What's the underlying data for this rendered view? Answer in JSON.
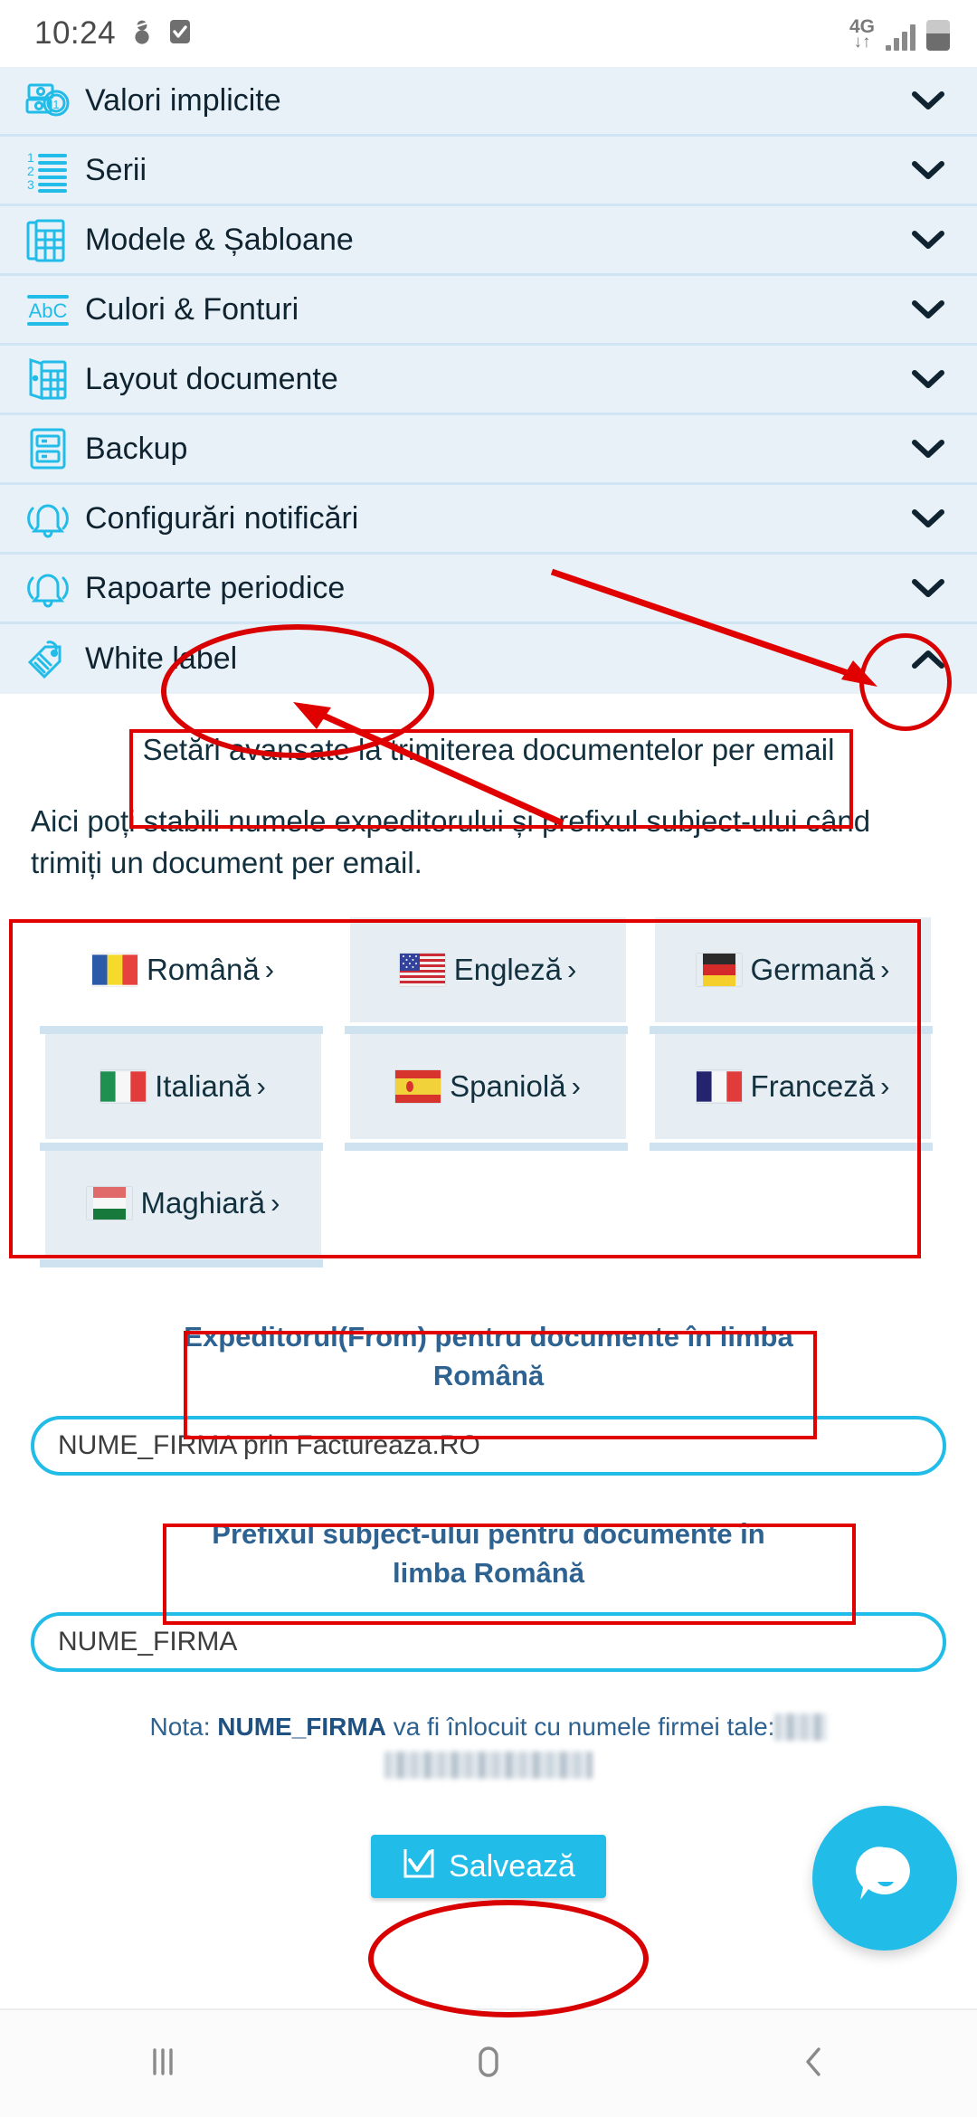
{
  "status_bar": {
    "clock": "10:24",
    "network_type": "4G",
    "icons": [
      "snowman-icon",
      "checkbox-icon",
      "data-transfer-icon",
      "signal-icon",
      "battery-icon"
    ]
  },
  "accordion": {
    "items": [
      {
        "label": "Valori implicite",
        "icon": "money-icon",
        "chevron": "chevron-down",
        "expanded": false
      },
      {
        "label": "Serii",
        "icon": "numbered-list-icon",
        "chevron": "chevron-down",
        "expanded": false
      },
      {
        "label": "Modele & Șabloane",
        "icon": "templates-icon",
        "chevron": "chevron-down",
        "expanded": false
      },
      {
        "label": "Culori & Fonturi",
        "icon": "abc-icon",
        "chevron": "chevron-down",
        "expanded": false
      },
      {
        "label": "Layout documente",
        "icon": "layout-icon",
        "chevron": "chevron-down",
        "expanded": false
      },
      {
        "label": "Backup",
        "icon": "server-icon",
        "chevron": "chevron-down",
        "expanded": false
      },
      {
        "label": "Configurări notificări",
        "icon": "bell-icon",
        "chevron": "chevron-down",
        "expanded": false
      },
      {
        "label": "Rapoarte periodice",
        "icon": "bell-icon",
        "chevron": "chevron-down",
        "expanded": false
      },
      {
        "label": "White label",
        "icon": "tag-icon",
        "chevron": "chevron-up",
        "expanded": true
      }
    ]
  },
  "panel": {
    "title": "Setări avansate la trimiterea documentelor per email",
    "description": "Aici poți stabili numele expeditorului și prefixul subject-ului când trimiți un document per email.",
    "languages": [
      {
        "name": "Română",
        "flag": "ro",
        "selected": true,
        "arrow": "›"
      },
      {
        "name": "Engleză",
        "flag": "us",
        "selected": false,
        "arrow": "›"
      },
      {
        "name": "Germană",
        "flag": "de",
        "selected": false,
        "arrow": "›"
      },
      {
        "name": "Italiană",
        "flag": "it",
        "selected": false,
        "arrow": "›"
      },
      {
        "name": "Spaniolă",
        "flag": "es",
        "selected": false,
        "arrow": "›"
      },
      {
        "name": "Franceză",
        "flag": "fr",
        "selected": false,
        "arrow": "›"
      },
      {
        "name": "Maghiară",
        "flag": "hu",
        "selected": false,
        "arrow": "›"
      }
    ],
    "from_label": "Expeditorul(From) pentru documente în limba Română",
    "from_value": "NUME_FIRMA prin Factureaza.RO",
    "subject_label": "Prefixul subject-ului pentru documente în limba Română",
    "subject_value": "NUME_FIRMA",
    "note_prefix": "Nota: ",
    "note_token": "NUME_FIRMA",
    "note_suffix": " va fi înlocuit cu numele firmei tale:",
    "save_label": "Salvează"
  },
  "chat": {
    "icon": "chat-bubble-icon"
  },
  "nav_bar": {
    "recents": "recents-icon",
    "home": "home-icon",
    "back": "back-icon"
  },
  "colors": {
    "accent": "#22bce8",
    "row_bg": "#e8f1f8",
    "row_divider": "#cfe5f3",
    "label_blue": "#2d6291",
    "annotation_red": "#e00000",
    "text_dark": "#12303d"
  }
}
